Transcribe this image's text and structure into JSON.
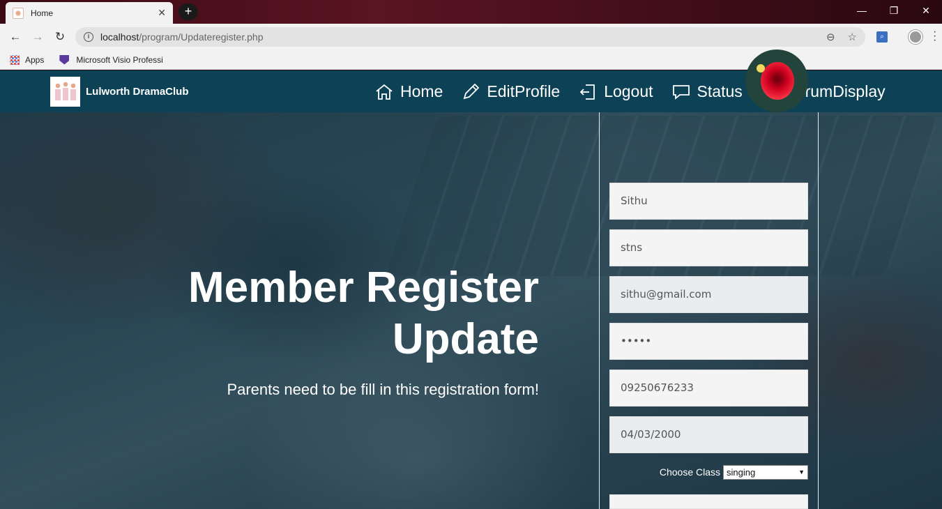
{
  "browser": {
    "tab_title": "Home",
    "tab_close": "✕",
    "new_tab": "+",
    "url_host": "localhost",
    "url_path": "/program/Updateregister.php",
    "bookmarks": [
      {
        "label": "Apps",
        "icon": "apps-grid-icon"
      },
      {
        "label": "Microsoft Visio Professi",
        "icon": "visio-icon"
      }
    ],
    "window_controls": [
      "—",
      "❐",
      "✕"
    ]
  },
  "site": {
    "brand": "Lulworth DramaClub",
    "nav": [
      {
        "label": "Home",
        "icon": "home-icon"
      },
      {
        "label": "EditProfile",
        "icon": "pencil-icon"
      },
      {
        "label": "Logout",
        "icon": "logout-icon"
      },
      {
        "label": "Status",
        "icon": "chat-icon"
      },
      {
        "label": "ForumDisplay",
        "icon": "list-menu-icon"
      }
    ],
    "hero": {
      "title_line1": "Member Register",
      "title_line2": "Update",
      "subtitle": "Parents need to be fill in this registration form!"
    },
    "form": {
      "name": "Sithu",
      "username": "stns",
      "email": "sithu@gmail.com",
      "password": "•••••",
      "phone": "09250676233",
      "dob": "04/03/2000",
      "class_label": "Choose Class",
      "class_value": "singing",
      "next_field": ""
    },
    "colors": {
      "navbar": "#0d4256",
      "overlay": "#103446",
      "field_bg": "#f4f4f4"
    }
  }
}
